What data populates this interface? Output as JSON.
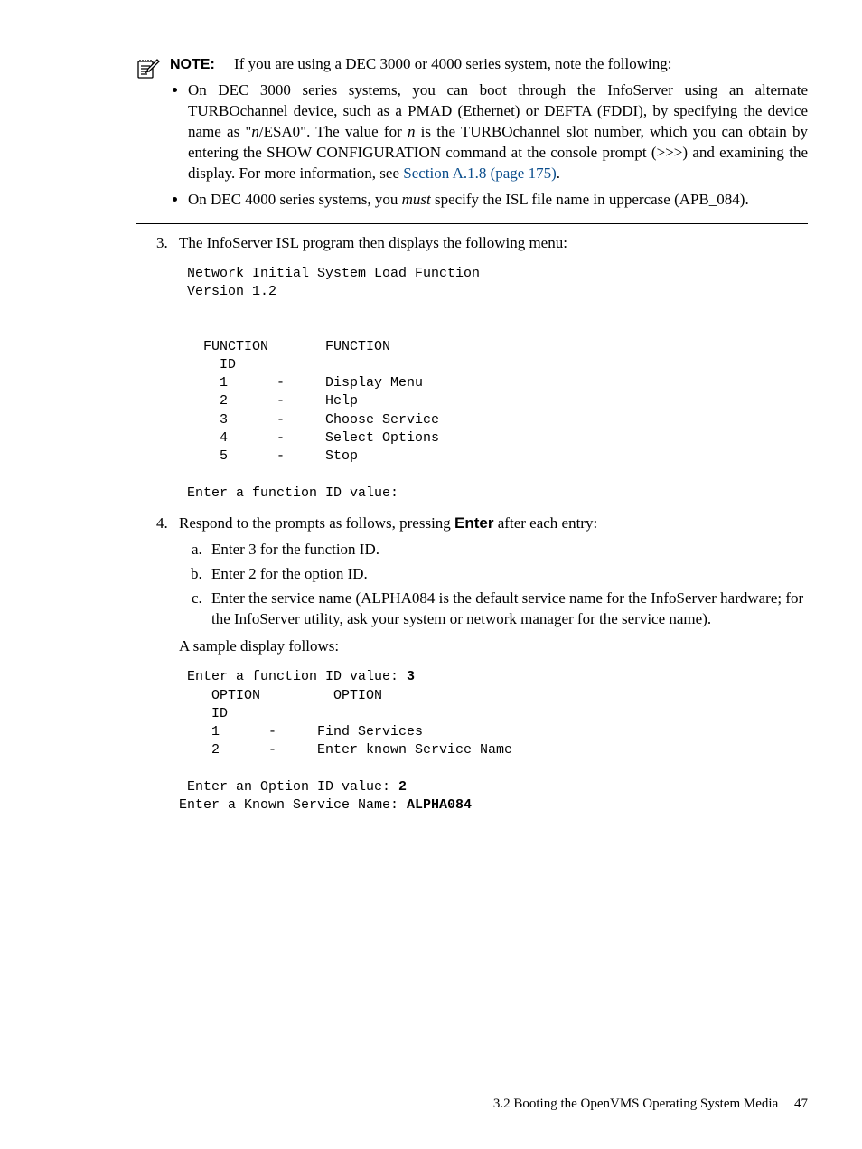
{
  "note": {
    "label": "NOTE:",
    "intro": "If you are using a DEC 3000 or 4000 series system, note the following:",
    "bullet1_a": "On DEC 3000 series systems, you can boot through the InfoServer using an alternate TURBOchannel device, such as a PMAD (Ethernet) or DEFTA (FDDI), by specifying the device name as \"",
    "bullet1_n1": "n",
    "bullet1_b": "/ESA0\". The value for ",
    "bullet1_n2": "n",
    "bullet1_c": " is the TURBOchannel slot number, which you can obtain by entering the SHOW CONFIGURATION command at the console prompt (>>>) and examining the display. For more information, see ",
    "bullet1_link": "Section A.1.8 (page 175)",
    "bullet1_d": ".",
    "bullet2_a": "On DEC 4000 series systems, you ",
    "bullet2_must": "must",
    "bullet2_b": " specify the ISL file name in uppercase (APB_084)."
  },
  "step3": {
    "text": "The InfoServer ISL program then displays the following menu:",
    "code": " Network Initial System Load Function\n Version 1.2\n\n\n   FUNCTION       FUNCTION\n     ID\n     1      -     Display Menu\n     2      -     Help\n     3      -     Choose Service\n     4      -     Select Options\n     5      -     Stop\n\n Enter a function ID value:"
  },
  "step4": {
    "intro_a": "Respond to the prompts as follows, pressing ",
    "enter": "Enter",
    "intro_b": " after each entry:",
    "a": "Enter 3 for the function ID.",
    "b": "Enter 2 for the option ID.",
    "c": "Enter the service name (ALPHA084 is the default service name for the InfoServer hardware; for the InfoServer utility, ask your system or network manager for the service name).",
    "sample_intro": "A sample display follows:",
    "code_line1": " Enter a function ID value: ",
    "code_val1": "3",
    "code_mid": "    OPTION         OPTION\n    ID\n    1      -     Find Services\n    2      -     Enter known Service Name\n",
    "code_line2": " Enter an Option ID value: ",
    "code_val2": "2",
    "code_line3": "Enter a Known Service Name: ",
    "code_val3": "ALPHA084"
  },
  "footer": {
    "section": "3.2 Booting the OpenVMS Operating System Media",
    "page": "47"
  }
}
